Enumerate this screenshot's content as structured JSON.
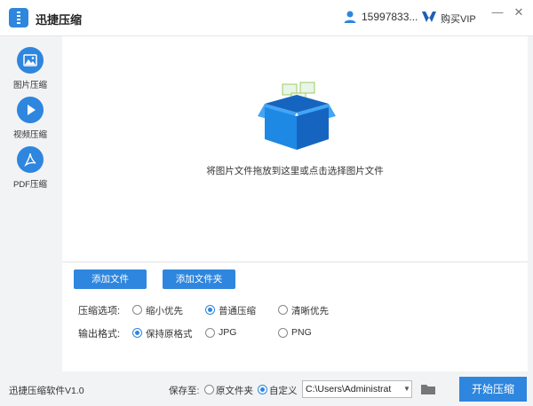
{
  "titlebar": {
    "app_title": "迅捷压缩",
    "phone": "15997833...",
    "vip_label": "购买VIP",
    "controls": [
      "minimize",
      "close"
    ]
  },
  "sidebar": {
    "items": [
      {
        "label": "图片压缩",
        "icon": "image-icon"
      },
      {
        "label": "视频压缩",
        "icon": "play-icon"
      },
      {
        "label": "PDF压缩",
        "icon": "pdf-icon"
      }
    ]
  },
  "main": {
    "drop_hint": "将图片文件拖放到这里或点击选择图片文件",
    "add_file_label": "添加文件",
    "add_folder_label": "添加文件夹",
    "compress_options": {
      "label": "压缩选项:",
      "options": [
        "缩小优先",
        "普通压缩",
        "清晰优先"
      ],
      "selected": "普通压缩"
    },
    "output_format": {
      "label": "输出格式:",
      "options": [
        "保持原格式",
        "JPG",
        "PNG"
      ],
      "selected": "保持原格式"
    }
  },
  "footer": {
    "version": "迅捷压缩软件V1.0",
    "save_to_label": "保存至:",
    "save_options": [
      "原文件夹",
      "自定义"
    ],
    "save_selected": "自定义",
    "path_value": "C:\\Users\\Administrat",
    "start_label": "开始压缩"
  },
  "colors": {
    "accent": "#2e86de",
    "background": "#f2f3f5",
    "panel": "#ffffff"
  }
}
